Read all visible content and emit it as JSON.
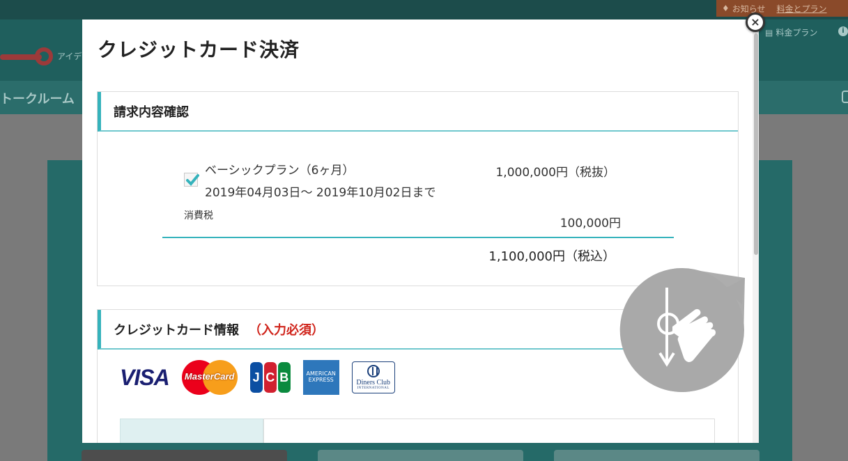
{
  "background": {
    "notices": [
      {
        "label": "お知らせ",
        "icon": "bell-icon"
      },
      {
        "label": "料金とプラン",
        "icon": "link"
      }
    ],
    "logo_text": "アイデ",
    "plan_link": "料金プラン",
    "nav_label": "トークルーム",
    "info_icon": "i"
  },
  "modal": {
    "title": "クレジットカード決済",
    "close_icon": "×"
  },
  "billing": {
    "heading": "請求内容確認",
    "plan_name": "ベーシックプラン（6ヶ月）",
    "period": "2019年04月03日～ 2019年10月02日まで",
    "price": "1,000,000円（税抜）",
    "tax_label": "消費税",
    "tax_value": "100,000円",
    "total": "1,100,000円（税込）",
    "checked": true
  },
  "card_info": {
    "heading": "クレジットカード情報",
    "required_label": "（入力必須）",
    "brands": {
      "visa": "VISA",
      "mastercard": "MasterCard",
      "jcb": [
        "J",
        "C",
        "B"
      ],
      "amex": [
        "AMERICAN",
        "EXPRESS"
      ],
      "diners": [
        "Diners Club",
        "INTERNATIONAL"
      ]
    }
  },
  "colors": {
    "accent": "#35b3bc",
    "required": "#d0241b",
    "jcb_blue": "#0b4ea2",
    "jcb_red": "#d1202f",
    "jcb_green": "#0a8a3e"
  }
}
